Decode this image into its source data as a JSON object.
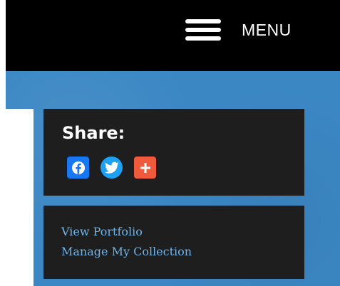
{
  "header": {
    "menu_label": "MENU",
    "menu_icon": "hamburger-icon"
  },
  "share": {
    "title": "Share:",
    "buttons": [
      {
        "name": "facebook",
        "icon": "facebook-icon",
        "color": "#1877f2"
      },
      {
        "name": "twitter",
        "icon": "twitter-icon",
        "color": "#1da1f2"
      },
      {
        "name": "add",
        "icon": "plus-icon",
        "color": "#ef5a3c"
      }
    ]
  },
  "links": {
    "items": [
      {
        "label": "View Portfolio"
      },
      {
        "label": "Manage My Collection"
      }
    ]
  },
  "colors": {
    "header_bg": "#000000",
    "band_bg": "#3b87c4",
    "card_bg": "#1e1e1e",
    "link_color": "#6fb4e8"
  }
}
